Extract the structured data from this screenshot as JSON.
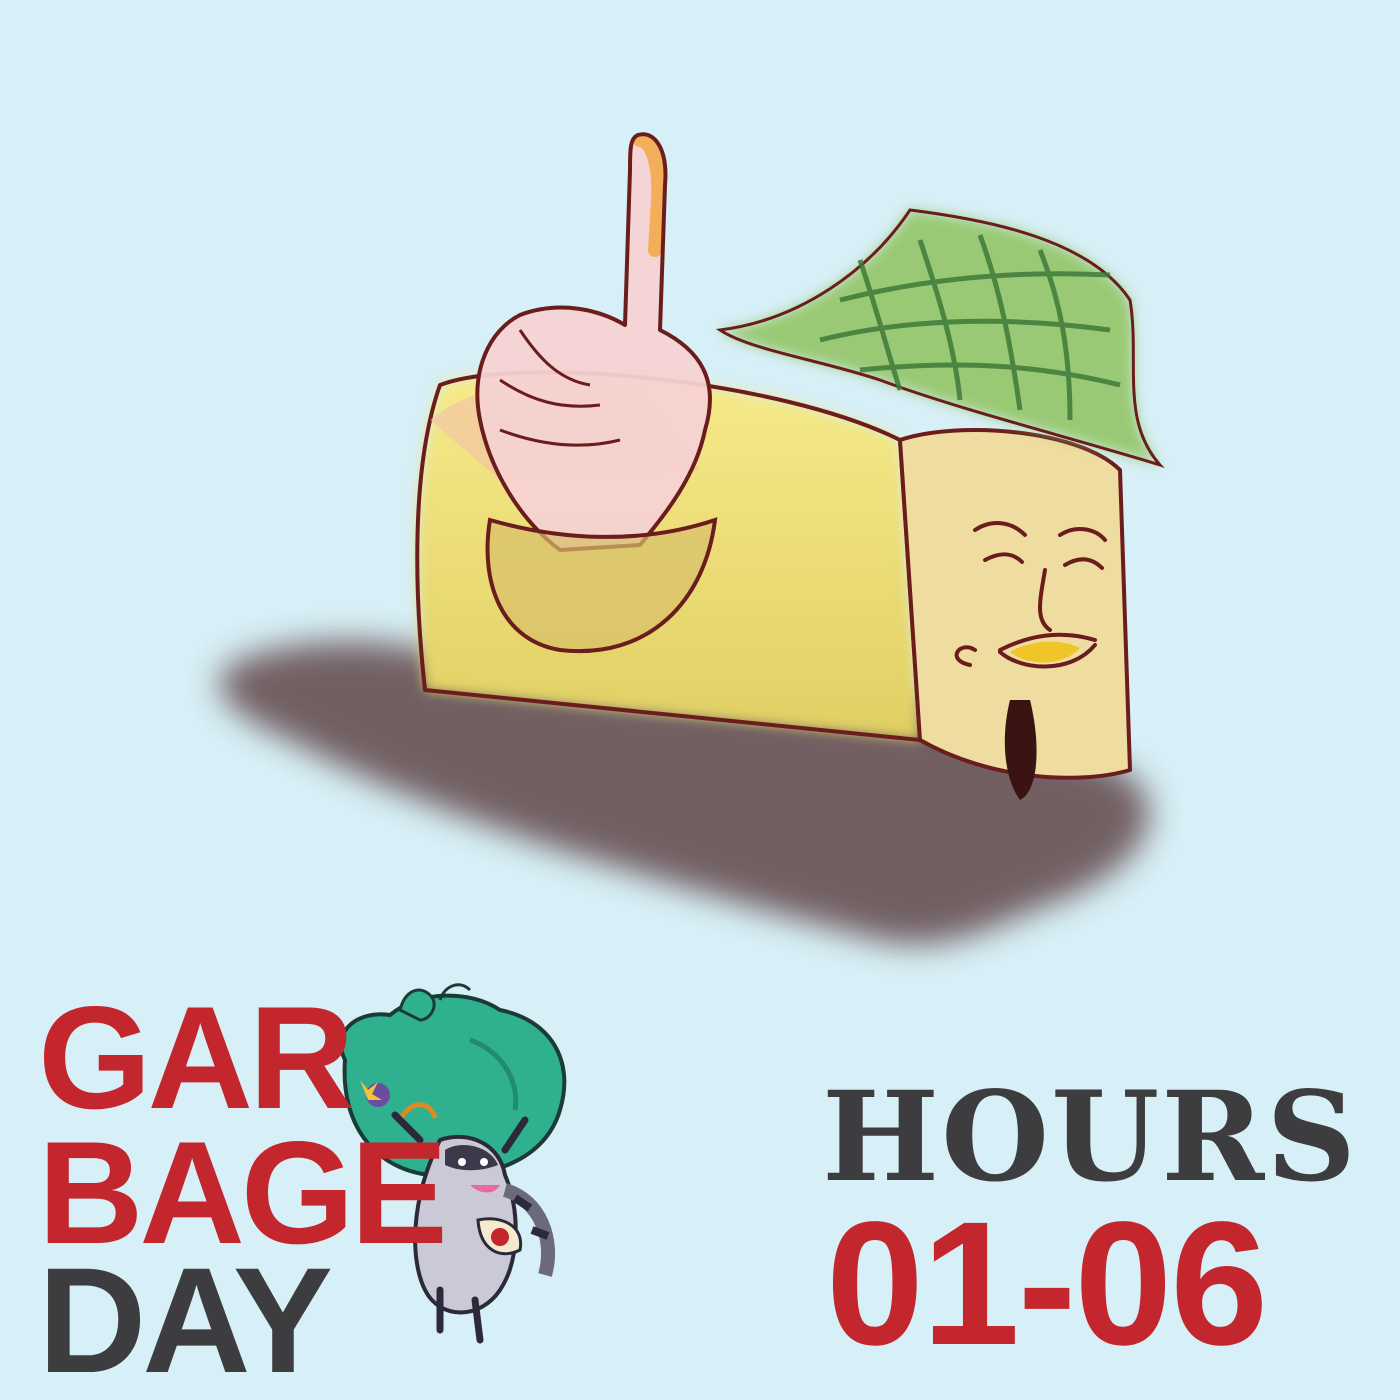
{
  "logo": {
    "line1": "GAR",
    "line2": "BAGE",
    "line3": "DAY",
    "mascot_icon": "raccoon-carrying-garbage-bag-icon"
  },
  "hours": {
    "label": "HOURS",
    "range": "01-06"
  },
  "artwork": {
    "subject": "taco-with-hat-and-raised-finger-illustration"
  },
  "colors": {
    "background": "#d7eff6",
    "brand_red": "#c4262e",
    "brand_dark": "#3d3d3f",
    "bag_green": "#2fb08e"
  }
}
